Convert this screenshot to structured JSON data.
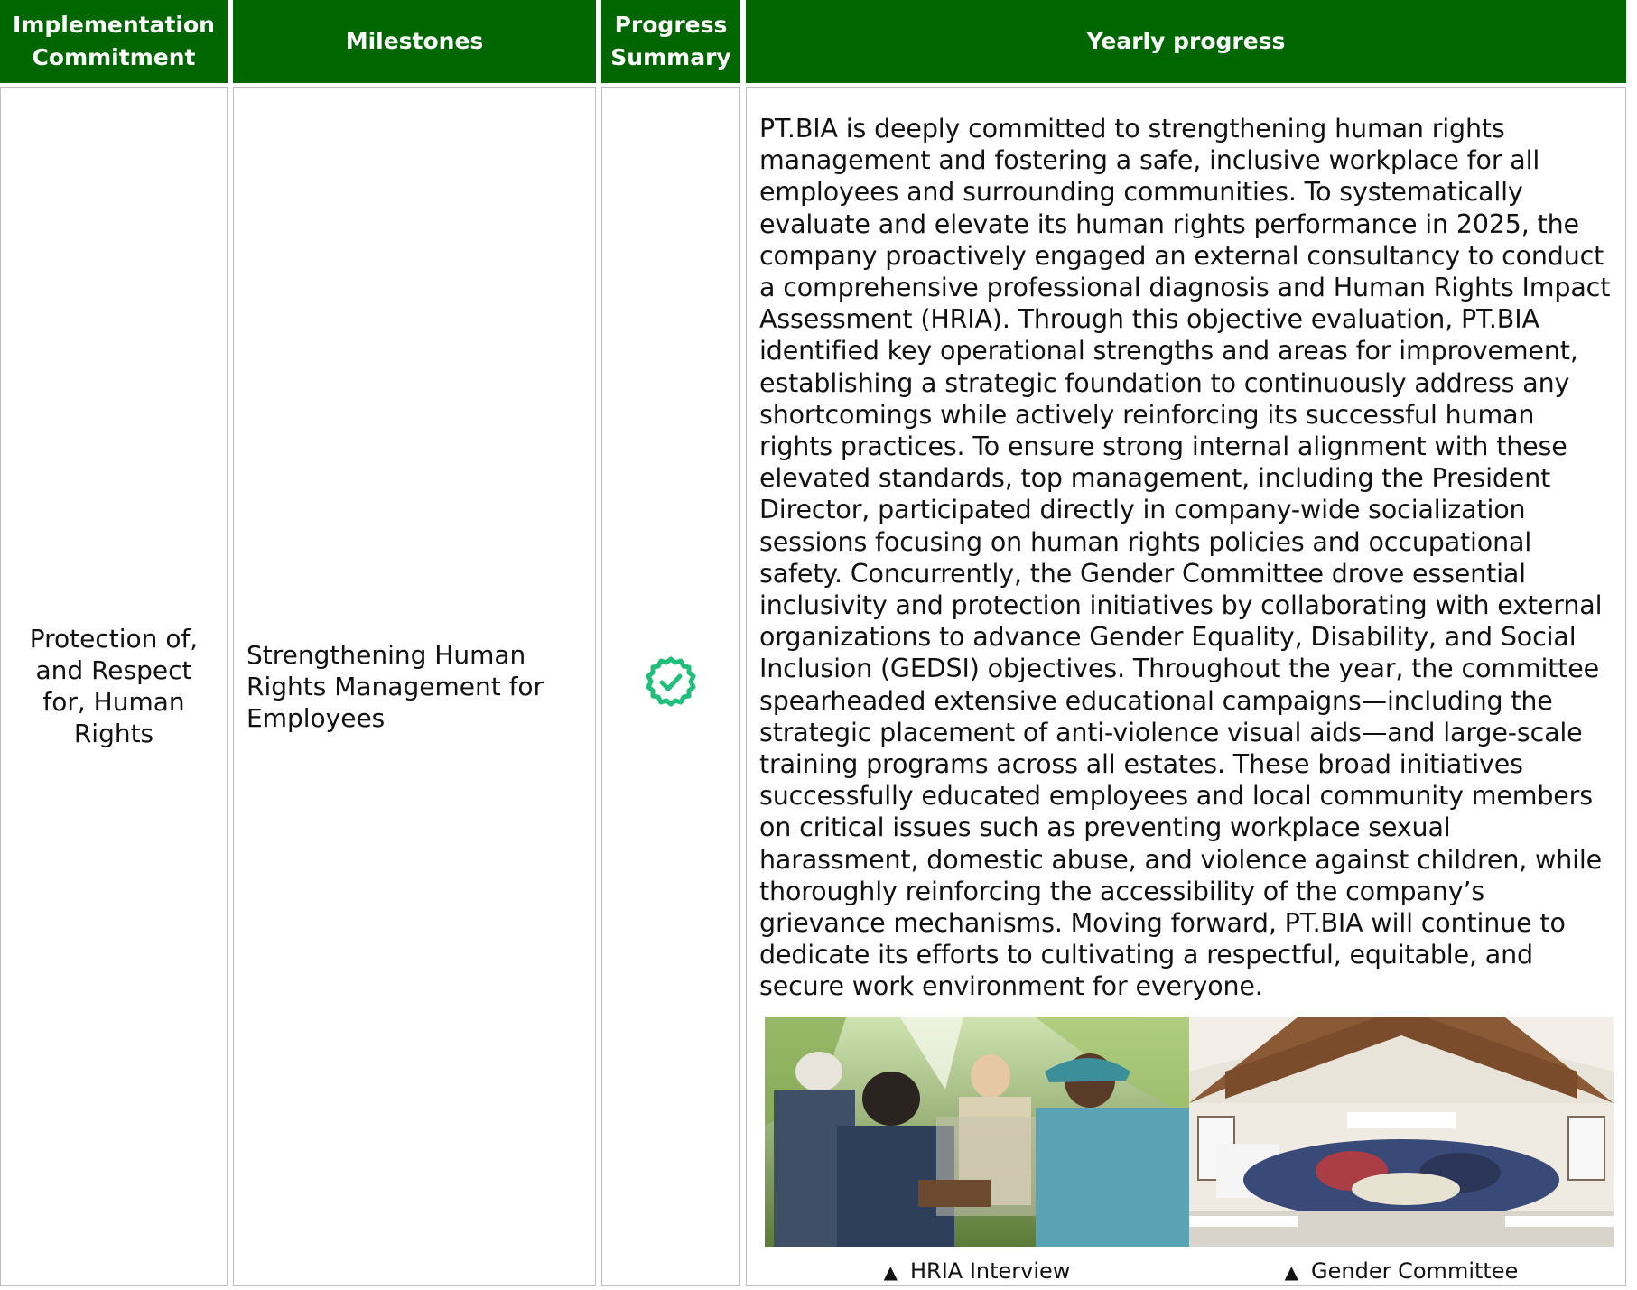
{
  "header": {
    "col1": "Implementation Commitment",
    "col2": "Milestones",
    "col3": "Progress Summary",
    "col4": "Yearly progress"
  },
  "row": {
    "commitment": "Protection of, and Respect for, Human Rights",
    "milestone": "Strengthening Human Rights Management for Employees",
    "status_icon": "check-badge-icon",
    "progress": "PT.BIA is deeply committed to strengthening human rights management and fostering a safe, inclusive workplace for all employees and surrounding communities. To systematically evaluate and elevate its human rights performance in 2025, the company proactively engaged an external consultancy to conduct a comprehensive professional diagnosis and Human Rights Impact Assessment (HRIA). Through this objective evaluation, PT.BIA identified key operational strengths and areas for improvement, establishing a strategic foundation to continuously address any shortcomings while actively reinforcing its successful human rights practices. To ensure strong internal alignment with these elevated standards, top management, including the President Director, participated directly in company-wide socialization sessions focusing on human rights policies and occupational safety. Concurrently, the Gender Committee drove essential inclusivity and protection initiatives by collaborating with external organizations to advance Gender Equality, Disability, and Social Inclusion (GEDSI) objectives. Throughout the year, the committee spearheaded extensive educational campaigns—including the strategic placement of anti-violence visual aids—and large-scale training programs across all estates. These broad initiatives successfully educated employees and local community members on critical issues such as preventing workplace sexual harassment, domestic abuse, and violence against children, while thoroughly reinforcing the accessibility of the company’s grievance mechanisms. Moving forward, PT.BIA will continue to dedicate its efforts to cultivating a respectful, equitable, and secure work environment for everyone.",
    "photos": [
      {
        "caption": "HRIA Interview",
        "marker": "▲"
      },
      {
        "caption": "Gender Committee",
        "marker": "▲"
      }
    ]
  },
  "colors": {
    "header_bg": "#006600",
    "header_text": "#ffffff",
    "check": "#1fbf7a",
    "border": "#bfbfbf"
  }
}
